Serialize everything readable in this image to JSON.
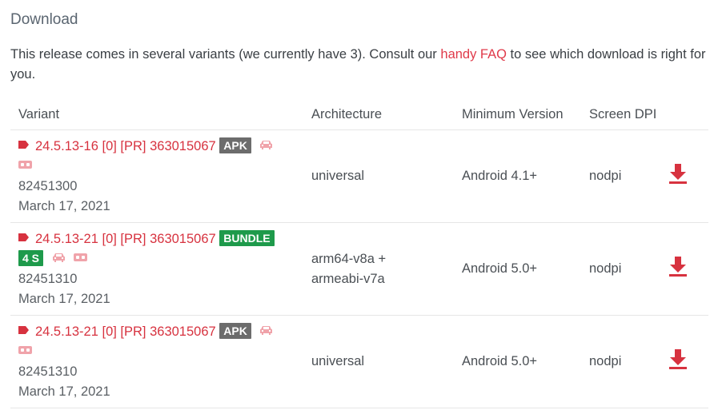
{
  "section": {
    "heading": "Download",
    "intro_prefix": "This release comes in several variants (we currently have 3). Consult our ",
    "intro_link": "handy FAQ",
    "intro_suffix": " to see which download is right for you."
  },
  "table": {
    "headers": {
      "variant": "Variant",
      "architecture": "Architecture",
      "min_version": "Minimum Version",
      "dpi": "Screen DPI"
    },
    "rows": [
      {
        "title": "24.5.13-16 [0] [PR] 363015067",
        "badge": "APK",
        "badge2": "",
        "build": "82451300",
        "date": "March 17, 2021",
        "arch_line1": "universal",
        "arch_line2": "",
        "min_version": "Android 4.1+",
        "dpi": "nodpi"
      },
      {
        "title": "24.5.13-21 [0] [PR] 363015067",
        "badge": "BUNDLE",
        "badge2": "4 S",
        "build": "82451310",
        "date": "March 17, 2021",
        "arch_line1": "arm64-v8a +",
        "arch_line2": "armeabi-v7a",
        "min_version": "Android 5.0+",
        "dpi": "nodpi"
      },
      {
        "title": "24.5.13-21 [0] [PR] 363015067",
        "badge": "APK",
        "badge2": "",
        "build": "82451310",
        "date": "March 17, 2021",
        "arch_line1": "universal",
        "arch_line2": "",
        "min_version": "Android 5.0+",
        "dpi": "nodpi"
      }
    ]
  },
  "colors": {
    "accent": "#d7323f",
    "badge_apk": "#6c6c6c",
    "badge_bundle": "#1e9a4b",
    "icon_light": "#f0a3aa"
  },
  "icons": {
    "tag": "tag-icon",
    "car": "car-icon",
    "vr": "vr-headset-icon",
    "download": "download-icon"
  }
}
